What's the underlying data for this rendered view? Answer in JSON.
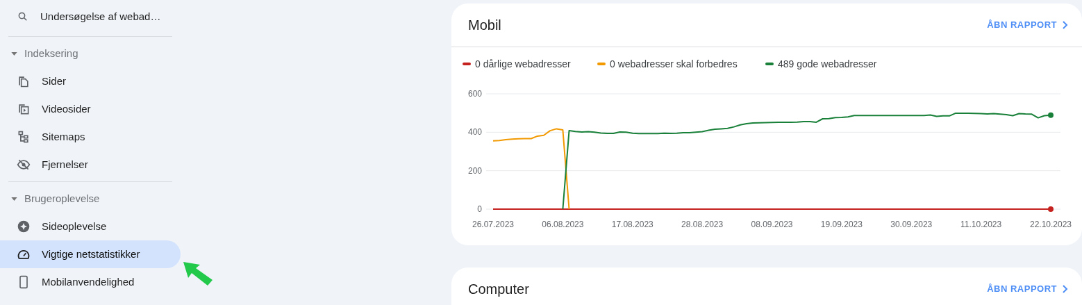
{
  "sidebar": {
    "search": {
      "label": "Undersøgelse af webad…"
    },
    "sections": [
      {
        "title": "Indeksering",
        "expanded": true,
        "items": [
          {
            "label": "Sider",
            "selected": false
          },
          {
            "label": "Videosider",
            "selected": false
          },
          {
            "label": "Sitemaps",
            "selected": false
          },
          {
            "label": "Fjernelser",
            "selected": false
          }
        ]
      },
      {
        "title": "Brugeroplevelse",
        "expanded": true,
        "items": [
          {
            "label": "Sideoplevelse",
            "selected": false
          },
          {
            "label": "Vigtige netstatistikker",
            "selected": true
          },
          {
            "label": "Mobilanvendelighed",
            "selected": false
          }
        ]
      }
    ]
  },
  "annotation": {
    "kind": "arrow",
    "color": "#22c94a"
  },
  "cards": [
    {
      "title": "Mobil",
      "link": "ÅBN RAPPORT",
      "chart_data": {
        "type": "line",
        "ylim": [
          0,
          600
        ],
        "yticks": [
          0,
          200,
          400,
          600
        ],
        "categories": [
          "26.07.2023",
          null,
          null,
          null,
          null,
          null,
          null,
          null,
          null,
          null,
          null,
          "06.08.2023",
          null,
          null,
          null,
          null,
          null,
          null,
          null,
          null,
          null,
          null,
          "17.08.2023",
          null,
          null,
          null,
          null,
          null,
          null,
          null,
          null,
          null,
          null,
          "28.08.2023",
          null,
          null,
          null,
          null,
          null,
          null,
          null,
          null,
          null,
          null,
          "08.09.2023",
          null,
          null,
          null,
          null,
          null,
          null,
          null,
          null,
          null,
          null,
          "19.09.2023",
          null,
          null,
          null,
          null,
          null,
          null,
          null,
          null,
          null,
          null,
          "30.09.2023",
          null,
          null,
          null,
          null,
          null,
          null,
          null,
          null,
          null,
          null,
          "11.10.2023",
          null,
          null,
          null,
          null,
          null,
          null,
          null,
          null,
          null,
          null,
          "22.10.2023"
        ],
        "series": [
          {
            "name": "0 dårlige webadresser",
            "color": "#c5221f",
            "values": [
              0,
              0,
              0,
              0,
              0,
              0,
              0,
              0,
              0,
              0,
              0,
              0,
              0,
              0,
              0,
              0,
              0,
              0,
              0,
              0,
              0,
              0,
              0,
              0,
              0,
              0,
              0,
              0,
              0,
              0,
              0,
              0,
              0,
              0,
              0,
              0,
              0,
              0,
              0,
              0,
              0,
              0,
              0,
              0,
              0,
              0,
              0,
              0,
              0,
              0,
              0,
              0,
              0,
              0,
              0,
              0,
              0,
              0,
              0,
              0,
              0,
              0,
              0,
              0,
              0,
              0,
              0,
              0,
              0,
              0,
              0,
              0,
              0,
              0,
              0,
              0,
              0,
              0,
              0,
              0,
              0,
              0,
              0,
              0,
              0,
              0,
              0,
              0,
              0
            ]
          },
          {
            "name": "0 webadresser skal forbedres",
            "color": "#f29900",
            "values": [
              355,
              357,
              361,
              364,
              366,
              367,
              367,
              380,
              384,
              408,
              418,
              412,
              0,
              null,
              null,
              null,
              null,
              null,
              null,
              null,
              null,
              null,
              null,
              null,
              null,
              null,
              null,
              null,
              null,
              null,
              null,
              null,
              null,
              null,
              null,
              null,
              null,
              null,
              null,
              null,
              null,
              null,
              null,
              null,
              null,
              null,
              null,
              null,
              null,
              null,
              null,
              null,
              null,
              null,
              null,
              null,
              null,
              null,
              null,
              null,
              null,
              null,
              null,
              null,
              null,
              null,
              null,
              null,
              null,
              null,
              null,
              null,
              null,
              null,
              null,
              null,
              null,
              null,
              null,
              null,
              null,
              null,
              null,
              null,
              null,
              null,
              null,
              null,
              null
            ]
          },
          {
            "name": "489 gode webadresser",
            "color": "#188038",
            "values": [
              null,
              null,
              null,
              null,
              null,
              null,
              null,
              null,
              null,
              null,
              null,
              0,
              408,
              404,
              401,
              403,
              400,
              396,
              394,
              394,
              401,
              400,
              395,
              393,
              393,
              393,
              393,
              395,
              394,
              395,
              398,
              398,
              400,
              403,
              410,
              416,
              418,
              420,
              428,
              438,
              445,
              448,
              449,
              450,
              451,
              452,
              452,
              452,
              453,
              455,
              455,
              452,
              470,
              471,
              476,
              477,
              480,
              487,
              487,
              487,
              487,
              487,
              487,
              487,
              487,
              487,
              487,
              487,
              487,
              490,
              483,
              485,
              485,
              499,
              499,
              499,
              498,
              497,
              495,
              497,
              494,
              492,
              486,
              497,
              495,
              494,
              475,
              486,
              489
            ]
          }
        ]
      }
    },
    {
      "title": "Computer",
      "link": "ÅBN RAPPORT"
    }
  ]
}
